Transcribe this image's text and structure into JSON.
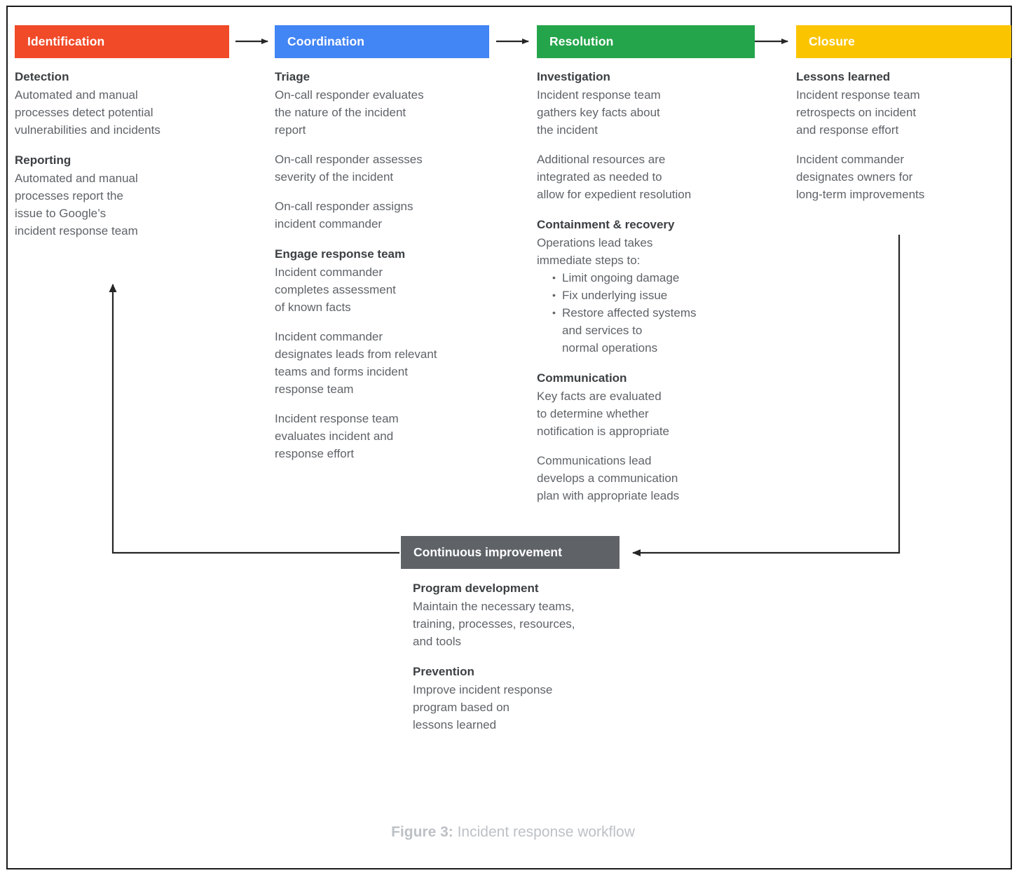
{
  "figure": {
    "caption_label": "Figure 3:",
    "caption_text": " Incident response workflow",
    "border_color": "#1b1b1b"
  },
  "phases": [
    {
      "id": "identification",
      "title": "Identification",
      "color": "#F04A28",
      "blocks": [
        {
          "title": "Detection",
          "paragraphs": [
            "Automated and manual\nprocesses detect potential\nvulnerabilities and incidents"
          ]
        },
        {
          "title": "Reporting",
          "paragraphs": [
            "Automated and manual\nprocesses report the\nissue to Google’s\nincident response team"
          ]
        }
      ]
    },
    {
      "id": "coordination",
      "title": "Coordination",
      "color": "#4285F4",
      "blocks": [
        {
          "title": "Triage",
          "paragraphs": [
            "On-call responder evaluates\nthe nature of the incident\nreport",
            "On-call responder assesses\nseverity of the incident",
            "On-call responder assigns\nincident commander"
          ]
        },
        {
          "title": "Engage response team",
          "paragraphs": [
            "Incident commander\ncompletes assessment\nof known facts",
            "Incident commander\ndesignates leads from relevant\nteams and forms incident\nresponse team",
            "Incident response team\nevaluates incident and\nresponse effort"
          ]
        }
      ]
    },
    {
      "id": "resolution",
      "title": "Resolution",
      "color": "#25A54B",
      "blocks": [
        {
          "title": "Investigation",
          "paragraphs": [
            "Incident response team\ngathers key facts about\nthe incident",
            "Additional resources are\nintegrated as needed to\nallow for expedient resolution"
          ]
        },
        {
          "title": "Containment & recovery",
          "paragraphs": [
            "Operations lead takes\nimmediate steps to:"
          ],
          "bullets": [
            "Limit ongoing damage",
            "Fix underlying issue",
            "Restore affected systems\nand services to\nnormal operations"
          ]
        },
        {
          "title": "Communication",
          "paragraphs": [
            "Key facts are evaluated\nto determine whether\nnotification is appropriate",
            "Communications lead\ndevelops a communication\nplan with appropriate leads"
          ]
        }
      ]
    },
    {
      "id": "closure",
      "title": "Closure",
      "color": "#FBC400",
      "blocks": [
        {
          "title": "Lessons learned",
          "paragraphs": [
            "Incident response team\nretrospects on incident\nand response effort",
            "Incident commander\ndesignates owners for\nlong-term improvements"
          ]
        }
      ]
    }
  ],
  "continuous_improvement": {
    "title": "Continuous improvement",
    "color": "#5f6368",
    "blocks": [
      {
        "title": "Program development",
        "paragraphs": [
          "Maintain the necessary teams,\ntraining, processes, resources,\nand tools"
        ]
      },
      {
        "title": "Prevention",
        "paragraphs": [
          "Improve incident response\nprogram based on\nlessons learned"
        ]
      }
    ]
  },
  "connectors": {
    "arrow_color": "#262626",
    "flow_arrows": [
      {
        "name": "identification-to-coordination"
      },
      {
        "name": "coordination-to-resolution"
      },
      {
        "name": "resolution-to-closure"
      },
      {
        "name": "closure-to-continuous-improvement"
      },
      {
        "name": "continuous-improvement-to-identification"
      }
    ]
  }
}
